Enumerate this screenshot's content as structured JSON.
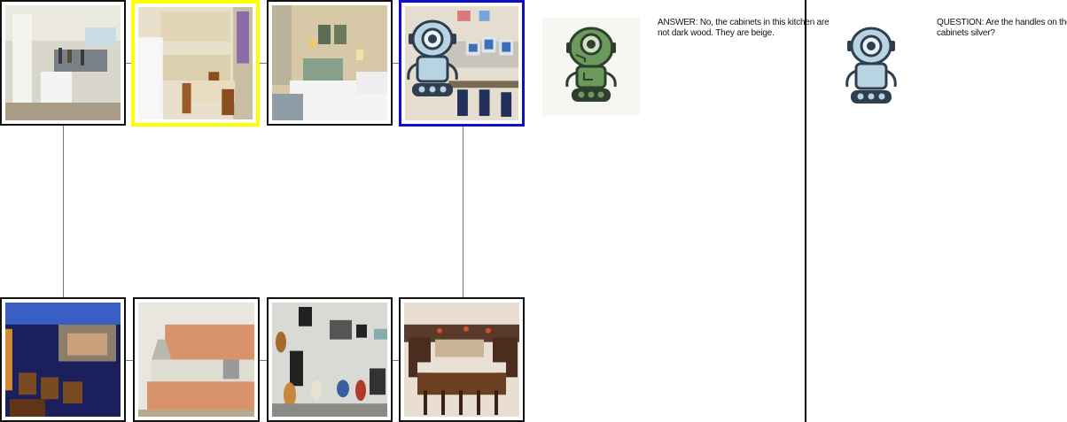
{
  "dialog": {
    "answer": "ANSWER: No, the cabinets in this kitchen are not dark wood. They are beige.",
    "question": "QUESTION: Are the handles on the cabinets silver?"
  },
  "top_row": [
    {
      "subject": "white kitchen with island and hanging pots",
      "highlight": "none"
    },
    {
      "subject": "kitchen with refrigerator, table and chairs",
      "highlight": "yellow"
    },
    {
      "subject": "bedroom with bed and framed pictures",
      "highlight": "none"
    },
    {
      "subject": "computer room with monitors",
      "highlight": "blue"
    }
  ],
  "bottom_row": [
    {
      "subject": "home theater with blue lighting"
    },
    {
      "subject": "modern peach kitchen cabinets"
    },
    {
      "subject": "music room with guitars and amplifiers"
    },
    {
      "subject": "kitchen bar with stools"
    }
  ],
  "colors": {
    "selected_frame": "#ffff00",
    "target_frame": "#1010cc",
    "answerer_robot": "#6b9a5b",
    "questioner_robot": "#b8d4e3"
  },
  "icons": {
    "answerer": "green-robot-icon",
    "questioner": "blue-robot-icon"
  }
}
